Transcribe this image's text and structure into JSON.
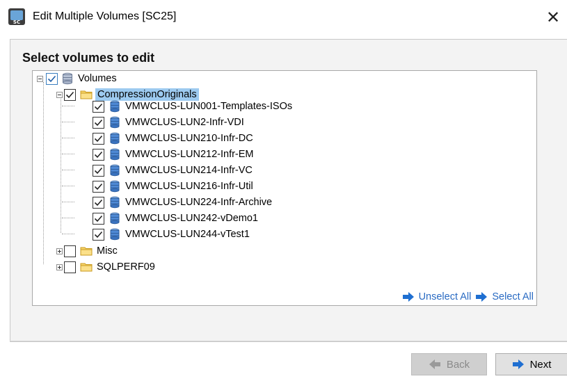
{
  "window": {
    "title": "Edit Multiple Volumes  [SC25]",
    "app_icon_text": "SC",
    "close_glyph": "✕"
  },
  "section_title": "Select volumes to edit",
  "tree": {
    "root": {
      "label": "Volumes",
      "checked": true,
      "expanded": true,
      "icon": "volumes-stack-icon"
    },
    "folders": [
      {
        "label": "CompressionOriginals",
        "checked": true,
        "expanded": true,
        "selected": true,
        "icon": "folder-icon",
        "items": [
          {
            "label": "VMWCLUS-LUN001-Templates-ISOs",
            "checked": true
          },
          {
            "label": "VMWCLUS-LUN2-Infr-VDI",
            "checked": true
          },
          {
            "label": "VMWCLUS-LUN210-Infr-DC",
            "checked": true
          },
          {
            "label": "VMWCLUS-LUN212-Infr-EM",
            "checked": true
          },
          {
            "label": "VMWCLUS-LUN214-Infr-VC",
            "checked": true
          },
          {
            "label": "VMWCLUS-LUN216-Infr-Util",
            "checked": true
          },
          {
            "label": "VMWCLUS-LUN224-Infr-Archive",
            "checked": true
          },
          {
            "label": "VMWCLUS-LUN242-vDemo1",
            "checked": true
          },
          {
            "label": "VMWCLUS-LUN244-vTest1",
            "checked": true
          }
        ]
      },
      {
        "label": "Misc",
        "checked": false,
        "expanded": false,
        "icon": "folder-icon"
      },
      {
        "label": "SQLPERF09",
        "checked": false,
        "expanded": false,
        "icon": "folder-icon"
      }
    ]
  },
  "links": {
    "unselect_all": "Unselect All",
    "select_all": "Select All"
  },
  "buttons": {
    "back": "Back",
    "next": "Next"
  },
  "colors": {
    "link": "#2a6bc3",
    "selection": "#9dcaf0",
    "arrow": "#1f6fd1",
    "folder": "#f5c542"
  }
}
